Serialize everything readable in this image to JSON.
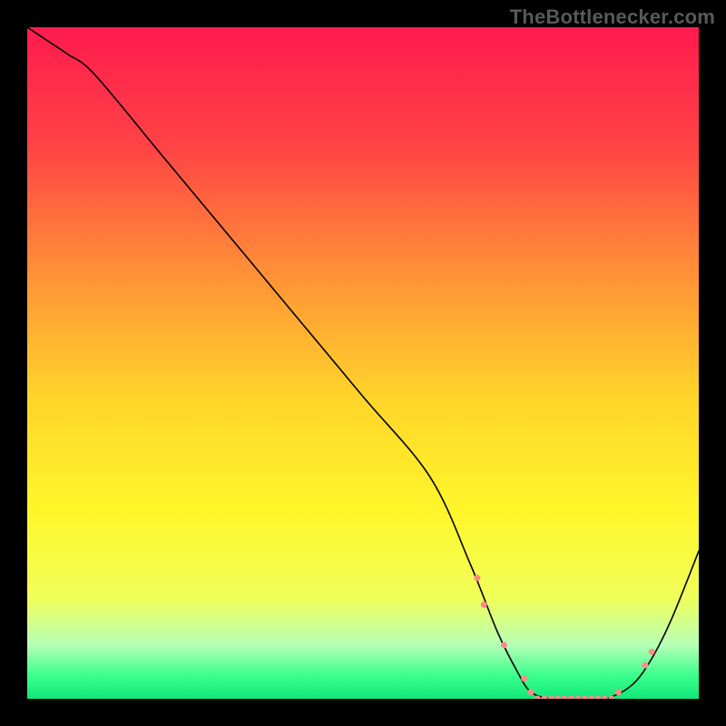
{
  "attribution": "TheBottlenecker.com",
  "chart_data": {
    "type": "line",
    "title": "",
    "xlabel": "",
    "ylabel": "",
    "xlim": [
      0,
      100
    ],
    "ylim": [
      0,
      100
    ],
    "background_gradient": {
      "stops": [
        {
          "pos": 0.0,
          "color": "#ff1a4e"
        },
        {
          "pos": 0.18,
          "color": "#ff4445"
        },
        {
          "pos": 0.35,
          "color": "#ff8a38"
        },
        {
          "pos": 0.55,
          "color": "#ffd42a"
        },
        {
          "pos": 0.72,
          "color": "#fff62a"
        },
        {
          "pos": 0.85,
          "color": "#f0ff5a"
        },
        {
          "pos": 0.92,
          "color": "#b6ffb6"
        },
        {
          "pos": 0.965,
          "color": "#3cff8c"
        },
        {
          "pos": 1.0,
          "color": "#10e878"
        }
      ]
    },
    "series": [
      {
        "name": "bottleneck-curve",
        "stroke": "#000000",
        "stroke_width": 1.6,
        "x": [
          0,
          3,
          6,
          10,
          20,
          30,
          40,
          50,
          60,
          66,
          70,
          73,
          75,
          78,
          82,
          86,
          90,
          93,
          96,
          100
        ],
        "values": [
          100,
          98,
          96,
          93,
          81,
          69,
          57,
          45,
          33,
          20,
          10,
          4,
          1,
          0,
          0,
          0,
          2,
          6,
          12,
          22
        ]
      }
    ],
    "markers": {
      "name": "datapoints",
      "stroke": "#ff8a8a",
      "fill": "#ff8a8a",
      "radius": 3.0,
      "x": [
        67,
        68,
        71,
        74,
        75,
        76,
        77,
        78,
        79,
        80,
        81,
        82,
        83,
        84,
        85,
        86,
        87,
        88,
        92,
        93
      ],
      "values": [
        18,
        14,
        8,
        3,
        1,
        0,
        0,
        0,
        0,
        0,
        0,
        0,
        0,
        0,
        0,
        0,
        0,
        1,
        5,
        7
      ]
    }
  }
}
